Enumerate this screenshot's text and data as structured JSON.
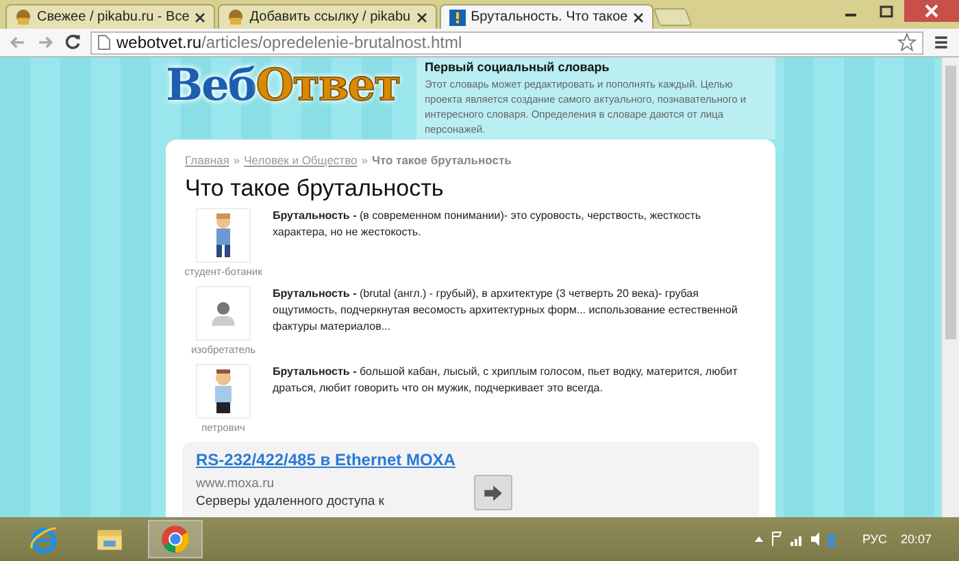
{
  "browser": {
    "tabs": [
      {
        "title": "Свежее / pikabu.ru - Все",
        "selected": false
      },
      {
        "title": "Добавить ссылку / pikabu",
        "selected": false
      },
      {
        "title": "Брутальность. Что такое",
        "selected": true
      }
    ],
    "url_host": "webotvet.ru",
    "url_path": "/articles/opredelenie-brutalnost.html"
  },
  "site": {
    "logo_left": "Веб",
    "logo_right": "Ответ",
    "intro_title": "Первый социальный словарь",
    "intro_text": "Этот словарь может редактировать и пополнять каждый. Целью проекта является создание самого актуального, познавательного и интересного словаря. Определения в словаре даются от лица персонажей."
  },
  "breadcrumb_separator": "»",
  "breadcrumbs": [
    {
      "label": "Главная",
      "kind": "link"
    },
    {
      "label": "Человек и Общество",
      "kind": "link"
    },
    {
      "label": "Что такое брутальность",
      "kind": "current"
    }
  ],
  "title": "Что такое брутальность",
  "definitions": [
    {
      "author": "студент-ботаник",
      "text": "**Брутальность -** (в современном понимании)- это суровость, черствость, жесткость характера, но не жестокость."
    },
    {
      "author": "изобретатель",
      "text": "**Брутальность -** (brutal (англ.) - грубый), в архитектуре (3 четверть 20 века)- грубая ощутимость, подчеркнутая весомость архитектурных форм... использование естественной фактуры материалов..."
    },
    {
      "author": "петрович",
      "text": "**Брутальность -** большой кабан, лысый, с хриплым голосом, пьет водку, матерится, любит драться, любит говорить что он мужик, подчеркивает это всегда."
    }
  ],
  "ad": {
    "title": "RS-232/422/485 в Ethernet MOXA",
    "url": "www.moxa.ru",
    "text": "Серверы удаленного доступа к"
  },
  "taskbar": {
    "apps": [
      {
        "selected": false
      },
      {
        "selected": false
      },
      {
        "selected": true
      }
    ],
    "language": "РУС",
    "time": "20:07"
  }
}
